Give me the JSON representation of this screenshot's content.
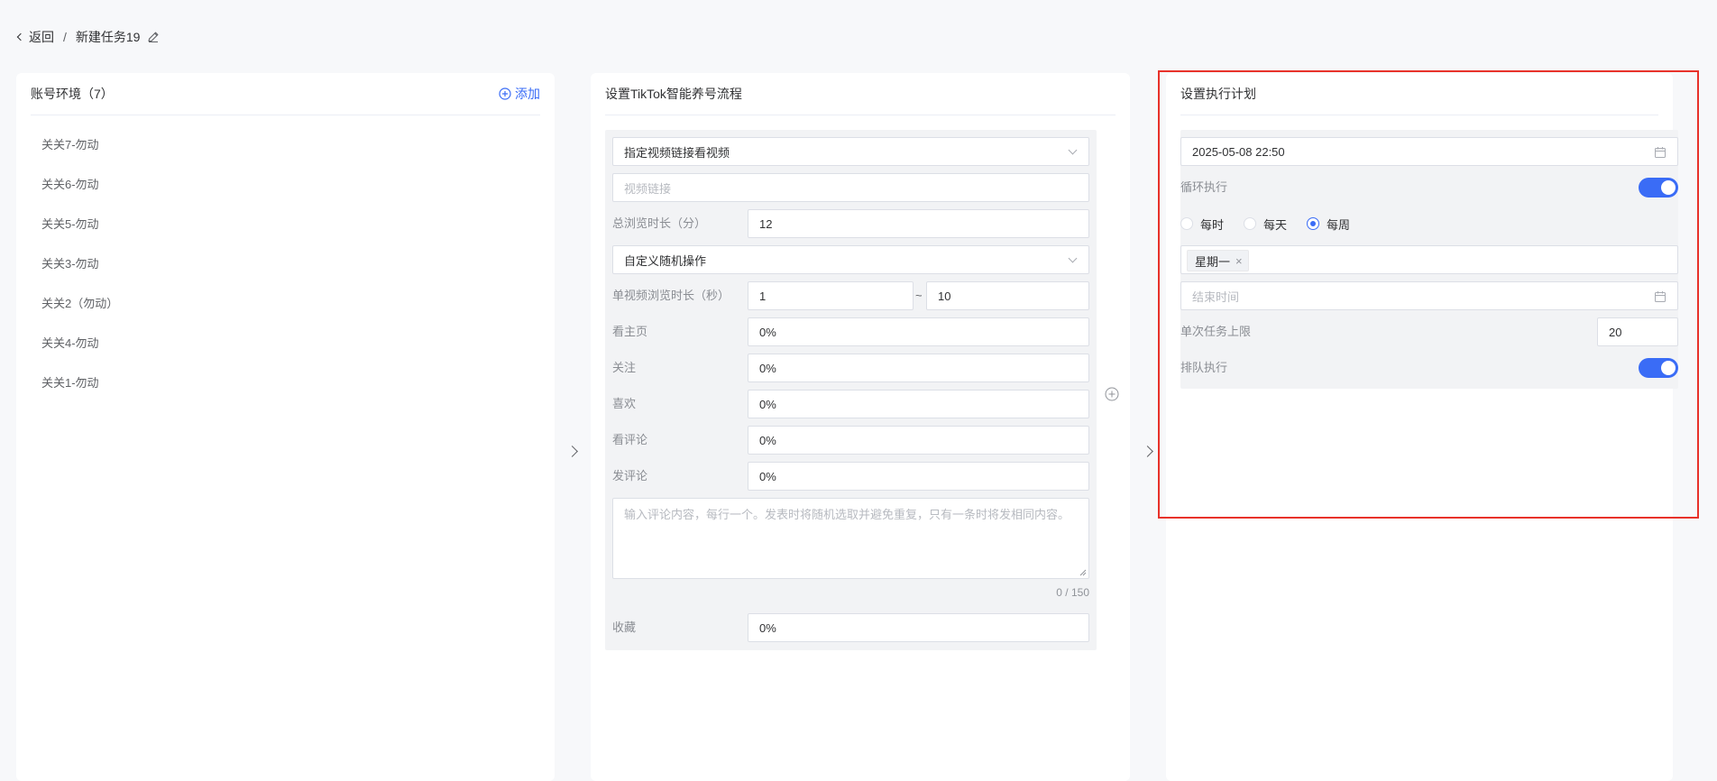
{
  "breadcrumb": {
    "back": "返回",
    "separator": "/",
    "title": "新建任务19"
  },
  "accounts_panel": {
    "title": "账号环境（7）",
    "add_label": "添加",
    "items": [
      "关关7-勿动",
      "关关6-勿动",
      "关关5-勿动",
      "关关3-勿动",
      "关关2（勿动）",
      "关关4-勿动",
      "关关1-勿动"
    ]
  },
  "flow_panel": {
    "title": "设置TikTok智能养号流程",
    "action_select": "指定视频链接看视频",
    "video_link_placeholder": "视频链接",
    "total_duration_label": "总浏览时长（分）",
    "total_duration_value": "12",
    "random_select": "自定义随机操作",
    "single_duration_label": "单视频浏览时长（秒）",
    "single_min": "1",
    "tilde": "~",
    "single_max": "10",
    "homepage_label": "看主页",
    "homepage_value": "0%",
    "follow_label": "关注",
    "follow_value": "0%",
    "like_label": "喜欢",
    "like_value": "0%",
    "view_comment_label": "看评论",
    "view_comment_value": "0%",
    "post_comment_label": "发评论",
    "post_comment_value": "0%",
    "comment_placeholder": "输入评论内容，每行一个。发表时将随机选取并避免重复，只有一条时将发相同内容。",
    "comment_counter": "0 / 150",
    "favorite_label": "收藏",
    "favorite_value": "0%"
  },
  "plan_panel": {
    "title": "设置执行计划",
    "start_time": "2025-05-08 22:50",
    "loop_label": "循环执行",
    "loop_on": true,
    "freq_options": [
      "每时",
      "每天",
      "每周"
    ],
    "freq_selected": "每周",
    "weekday_tag": "星期一",
    "tag_close": "×",
    "end_time_placeholder": "结束时间",
    "task_limit_label": "单次任务上限",
    "task_limit_value": "20",
    "queue_label": "排队执行",
    "queue_on": true
  },
  "colors": {
    "accent": "#3a6cf6",
    "highlight": "#e8322a",
    "panel_bg": "#f2f3f5"
  }
}
